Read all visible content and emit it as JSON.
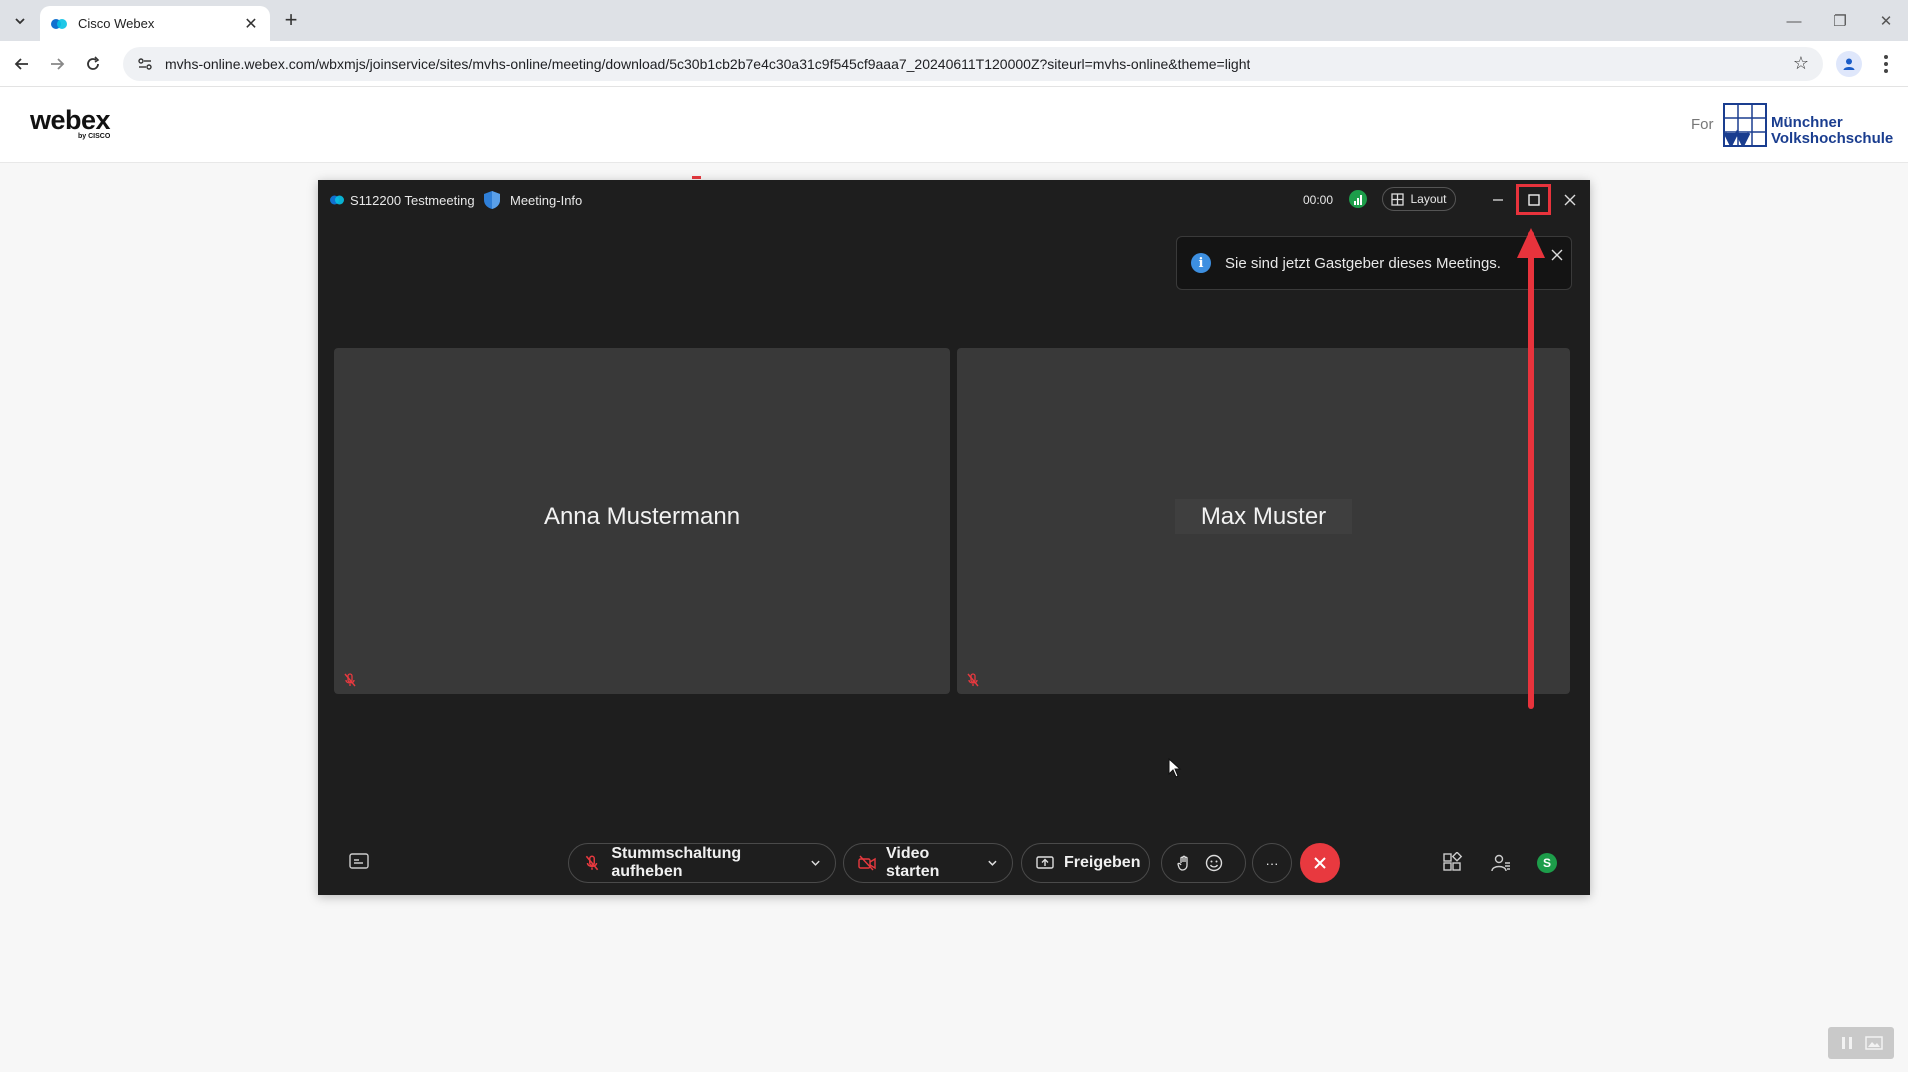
{
  "browser": {
    "tab_title": "Cisco Webex",
    "url": "mvhs-online.webex.com/wbxmjs/joinservice/sites/mvhs-online/meeting/download/5c30b1cb2b7e4c30a31c9f545cf9aaa7_20240611T120000Z?siteurl=mvhs-online&theme=light"
  },
  "site": {
    "logo_text": "webex",
    "logo_sub": "by CISCO",
    "for_label": "For",
    "partner_line1": "Münchner",
    "partner_line2": "Volkshochschule"
  },
  "meeting": {
    "name": "S112200 Testmeeting",
    "info_label": "Meeting-Info",
    "timer": "00:00",
    "layout_label": "Layout",
    "toast_message": "Sie sind jetzt Gastgeber dieses Meetings.",
    "participants": [
      {
        "name": "Anna Mustermann",
        "muted": true
      },
      {
        "name": "Max Muster",
        "muted": true
      }
    ],
    "controls": {
      "unmute_label": "Stummschaltung aufheben",
      "video_label": "Video starten",
      "share_label": "Freigeben",
      "more_label": "···",
      "avatar_initial": "S"
    }
  },
  "colors": {
    "accent_red": "#e8393f",
    "status_green": "#1d9d4a",
    "info_blue": "#3d8fe0",
    "meeting_bg": "#1e1e1e",
    "tile_bg": "#393939"
  }
}
